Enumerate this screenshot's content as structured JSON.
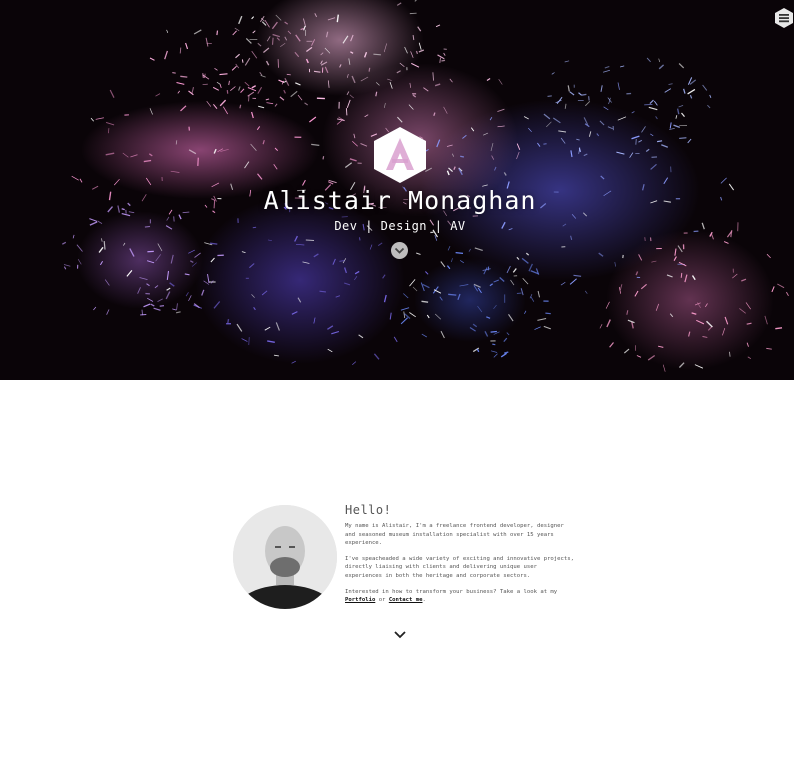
{
  "hero": {
    "title": "Alistair Monaghan",
    "subtitle": "Dev | Design | AV",
    "menu_icon": "hexagon-menu-icon",
    "logo_icon": "hexagon-a-logo",
    "scroll_icon": "chevron-down-icon"
  },
  "about": {
    "heading": "Hello!",
    "para1": "My name is Alistair, I'm a freelance frontend developer, designer and seasoned museum installation specialist with over 15 years experience.",
    "para2": "I've speacheaded a wide variety of exciting and innovative projects, directly liaising with clients and delivering unique user experiences in both the heritage and corporate sectors.",
    "para3_prefix": "Interested in how to transform your business? Take a look at my",
    "portfolio_link": "Portfolio",
    "or_text": "or",
    "contact_link": "Contact me",
    "para3_suffix": ".",
    "next_icon": "chevron-down-icon"
  },
  "colors": {
    "hero_bg": "#0a0408",
    "page_bg": "#ffffff",
    "text": "#555555"
  }
}
